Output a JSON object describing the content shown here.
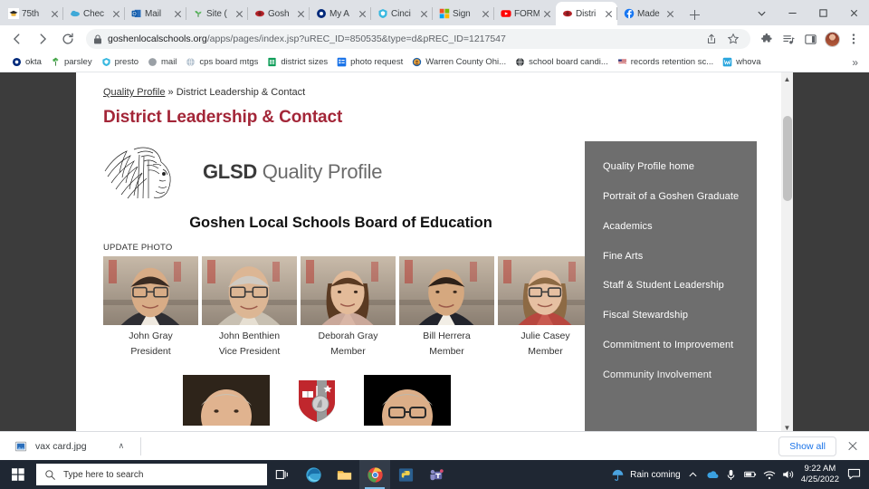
{
  "browser": {
    "tabs": [
      {
        "label": "75th ",
        "icon": "graduation-cap-favicon",
        "active": false
      },
      {
        "label": "Chec",
        "icon": "cloud-favicon",
        "active": false
      },
      {
        "label": "Mail",
        "icon": "outlook-favicon",
        "active": false
      },
      {
        "label": "Site (",
        "icon": "sprout-favicon",
        "active": false
      },
      {
        "label": "Gosh",
        "icon": "goshen-favicon",
        "active": false
      },
      {
        "label": "My A",
        "icon": "okta-favicon",
        "active": false
      },
      {
        "label": "Cinci",
        "icon": "presto-favicon",
        "active": false
      },
      {
        "label": "Sign",
        "icon": "microsoft-favicon",
        "active": false
      },
      {
        "label": "FORM",
        "icon": "youtube-favicon",
        "active": false
      },
      {
        "label": "Distri",
        "icon": "goshen-favicon",
        "active": true
      },
      {
        "label": "Made",
        "icon": "facebook-favicon",
        "active": false
      }
    ],
    "new_tab_tooltip": "New tab",
    "window_controls": [
      "minimize",
      "maximize",
      "close"
    ],
    "nav": {
      "back": "Back",
      "forward": "Forward",
      "reload": "Reload"
    },
    "omnibox": {
      "lock_icon": "lock-icon",
      "url_domain": "goshenlocalschools.org",
      "url_path": "/apps/pages/index.jsp?uREC_ID=850535&type=d&pREC_ID=1217547"
    },
    "toolbar_icons": [
      "share-icon",
      "bookmark-star-icon",
      "extensions-puzzle-icon",
      "media-control-icon",
      "side-panel-icon",
      "profile-avatar",
      "chrome-menu-icon"
    ],
    "bookmarks": [
      {
        "label": "okta",
        "icon": "okta-icon"
      },
      {
        "label": "parsley",
        "icon": "parsley-icon"
      },
      {
        "label": "presto",
        "icon": "presto-icon"
      },
      {
        "label": "mail",
        "icon": "outlook-icon"
      },
      {
        "label": "cps board mtgs",
        "icon": "globe-icon"
      },
      {
        "label": "district sizes",
        "icon": "sheets-icon"
      },
      {
        "label": "photo request",
        "icon": "forms-icon"
      },
      {
        "label": "Warren County Ohi...",
        "icon": "seal-icon"
      },
      {
        "label": "school board candi...",
        "icon": "globe-dark-icon"
      },
      {
        "label": "records retention sc...",
        "icon": "flag-icon"
      },
      {
        "label": "whova",
        "icon": "whova-icon"
      }
    ],
    "bookmarks_overflow": "»"
  },
  "page": {
    "breadcrumb": {
      "parent": "Quality Profile",
      "separator": " » ",
      "current": "District Leadership & Contact"
    },
    "title": "District Leadership & Contact",
    "logo": {
      "brand": "GLSD",
      "tagline": " Quality Profile",
      "mark": "headdress-logo"
    },
    "board_title": "Goshen Local Schools Board of Education",
    "update_photo_label": "UPDATE PHOTO",
    "members": [
      {
        "name": "John Gray",
        "role": "President"
      },
      {
        "name": "John Benthien",
        "role": "Vice President"
      },
      {
        "name": "Deborah Gray",
        "role": "Member"
      },
      {
        "name": "Bill Herrera",
        "role": "Member"
      },
      {
        "name": "Julie Casey",
        "role": "Member"
      }
    ],
    "second_row": [
      {
        "kind": "photo",
        "name": "staff-photo-1"
      },
      {
        "kind": "crest",
        "name": "goshen-school-crest"
      },
      {
        "kind": "photo",
        "name": "staff-photo-2"
      }
    ],
    "sidenav": [
      {
        "label": "Quality Profile home"
      },
      {
        "label": "Portrait of a Goshen Graduate"
      },
      {
        "label": "Academics"
      },
      {
        "label": "Fine Arts"
      },
      {
        "label": "Staff & Student Leadership"
      },
      {
        "label": "Fiscal Stewardship"
      },
      {
        "label": "Commitment to Improvement"
      },
      {
        "label": "Community Involvement"
      }
    ],
    "accent_color": "#a32638",
    "sidenav_color": "#6e6e6e"
  },
  "download_shelf": {
    "file_name": "vax card.jpg",
    "file_icon": "image-file-icon",
    "caret": "∧",
    "show_all_label": "Show all",
    "close_label": "Close"
  },
  "taskbar": {
    "start_label": "Start",
    "search_placeholder": "Type here to search",
    "search_icon": "magnifier-icon",
    "apps": [
      {
        "name": "task-view-icon"
      },
      {
        "name": "edge-icon"
      },
      {
        "name": "file-explorer-icon"
      },
      {
        "name": "chrome-icon",
        "active": true
      },
      {
        "name": "python-idle-icon"
      },
      {
        "name": "teams-icon"
      }
    ],
    "weather_text": "Rain coming",
    "weather_icon": "umbrella-icon",
    "tray_icons": [
      "show-hidden-icons-caret",
      "onedrive-icon",
      "microphone-icon",
      "battery-icon",
      "wifi-icon",
      "volume-icon"
    ],
    "clock_time": "9:22 AM",
    "clock_date": "4/25/2022",
    "notification_icon": "notification-icon"
  }
}
